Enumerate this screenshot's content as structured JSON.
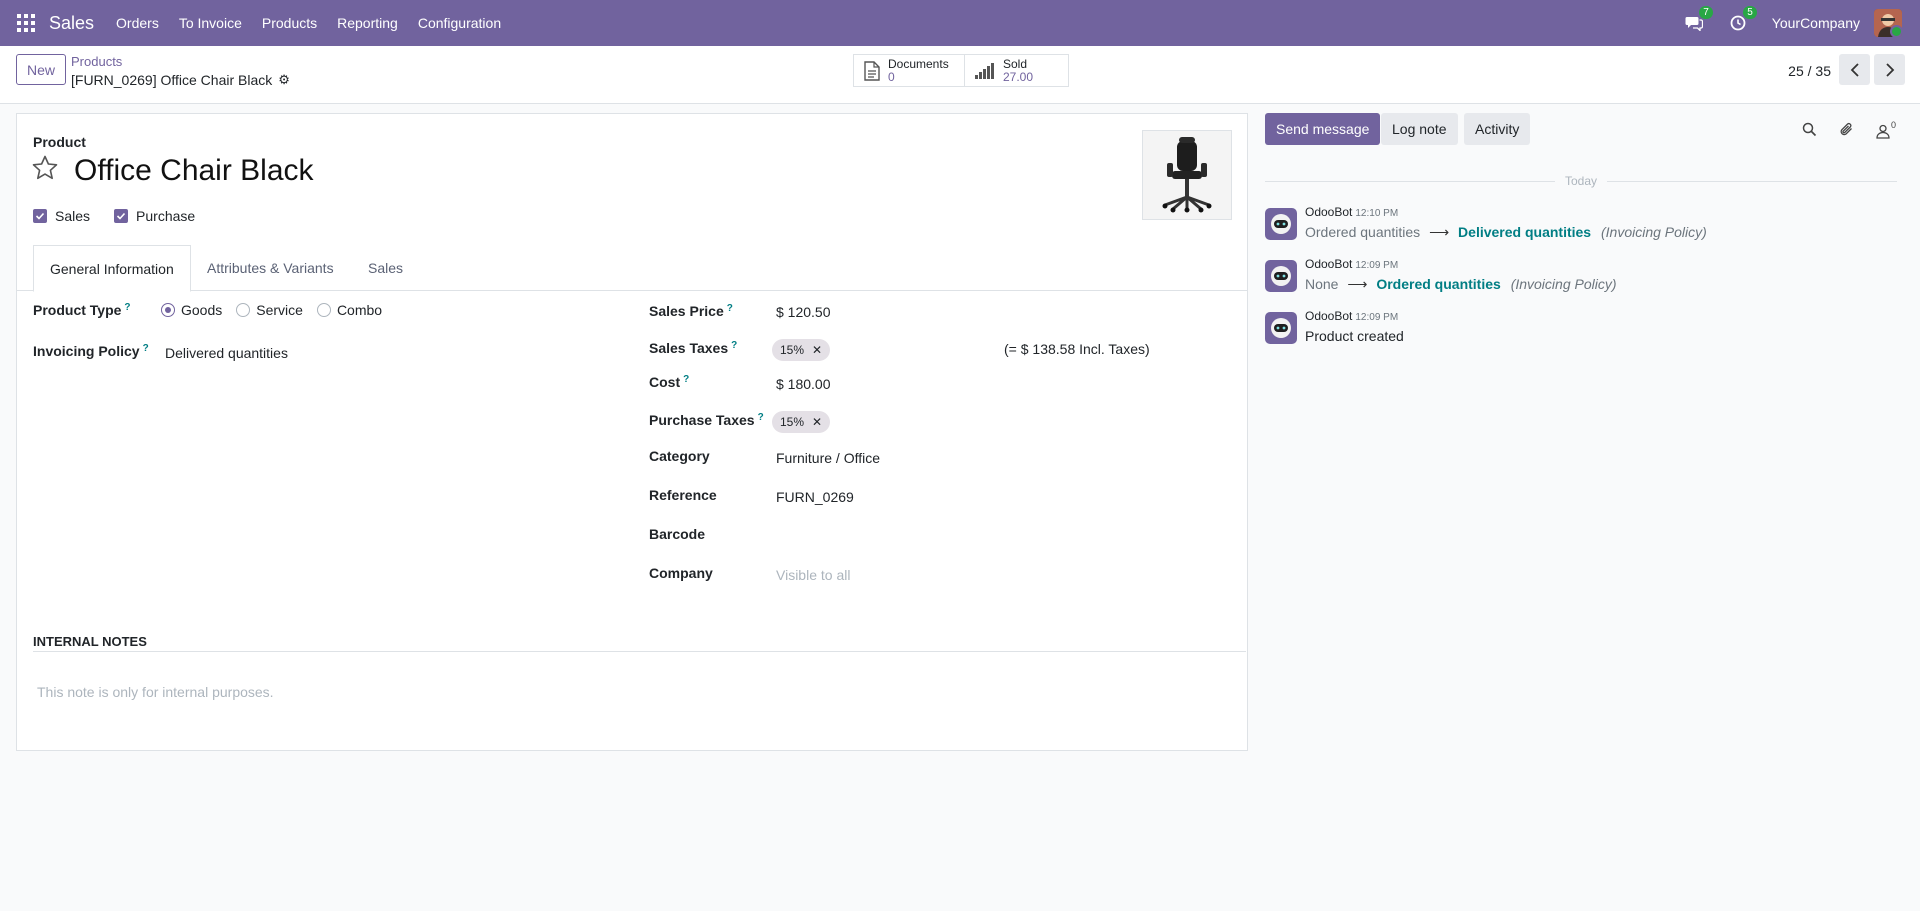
{
  "navbar": {
    "app_name": "Sales",
    "menu": [
      "Orders",
      "To Invoice",
      "Products",
      "Reporting",
      "Configuration"
    ],
    "messages_count": "7",
    "activities_count": "5",
    "company": "YourCompany",
    "color": "#71639e"
  },
  "control": {
    "new_label": "New",
    "breadcrumb": "Products",
    "record_title": "[FURN_0269] Office Chair Black",
    "stats": {
      "documents_label": "Documents",
      "documents_value": "0",
      "sold_label": "Sold",
      "sold_value": "27.00"
    },
    "pager": "25 / 35"
  },
  "form": {
    "product_label": "Product",
    "name": "Office Chair Black",
    "sales_check": "Sales",
    "purchase_check": "Purchase",
    "tabs": [
      "General Information",
      "Attributes & Variants",
      "Sales"
    ],
    "product_type_label": "Product Type",
    "product_type_options": [
      "Goods",
      "Service",
      "Combo"
    ],
    "product_type_selected": "Goods",
    "invoicing_policy_label": "Invoicing Policy",
    "invoicing_policy_value": "Delivered quantities",
    "sales_price_label": "Sales Price",
    "sales_price_value": "$ 120.50",
    "sales_taxes_label": "Sales Taxes",
    "sales_taxes_tag": "15%",
    "sales_taxes_incl": "(= $ 138.58 Incl. Taxes)",
    "cost_label": "Cost",
    "cost_value": "$ 180.00",
    "purchase_taxes_label": "Purchase Taxes",
    "purchase_taxes_tag": "15%",
    "category_label": "Category",
    "category_value": "Furniture / Office",
    "reference_label": "Reference",
    "reference_value": "FURN_0269",
    "barcode_label": "Barcode",
    "company_label": "Company",
    "company_placeholder": "Visible to all",
    "help_mark": "?",
    "notes_title": "INTERNAL NOTES",
    "notes_placeholder": "This note is only for internal purposes."
  },
  "chatter": {
    "send_message": "Send message",
    "log_note": "Log note",
    "activity": "Activity",
    "followers_count": "0",
    "today": "Today",
    "messages": [
      {
        "author": "OdooBot",
        "time": "12:10 PM",
        "old": "Ordered quantities",
        "new": "Delivered quantities",
        "field": "(Invoicing Policy)"
      },
      {
        "author": "OdooBot",
        "time": "12:09 PM",
        "old": "None",
        "new": "Ordered quantities",
        "field": "(Invoicing Policy)"
      },
      {
        "author": "OdooBot",
        "time": "12:09 PM",
        "text": "Product created"
      }
    ]
  }
}
